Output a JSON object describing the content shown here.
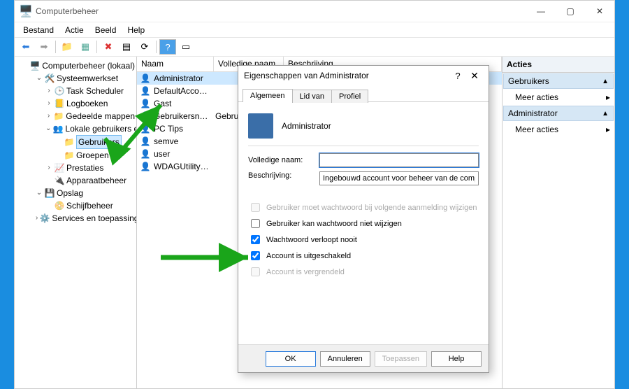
{
  "window": {
    "title": "Computerbeheer",
    "menus": [
      "Bestand",
      "Actie",
      "Beeld",
      "Help"
    ]
  },
  "tree": {
    "root": "Computerbeheer (lokaal)",
    "system": "Systeemwerkset",
    "scheduler": "Task Scheduler",
    "logs": "Logboeken",
    "shared": "Gedeelde mappen",
    "lusers": "Lokale gebruikers en gro…",
    "users": "Gebruikers",
    "groups": "Groepen",
    "perf": "Prestaties",
    "devmgr": "Apparaatbeheer",
    "storage": "Opslag",
    "disk": "Schijfbeheer",
    "services": "Services en toepassingen"
  },
  "list": {
    "col1": "Naam",
    "col2": "Volledige naam",
    "col3": "Beschrijving",
    "rows": [
      {
        "name": "Administrator",
        "full": ""
      },
      {
        "name": "DefaultAcco…",
        "full": ""
      },
      {
        "name": "Gast",
        "full": ""
      },
      {
        "name": "Gebruikersn…",
        "full": "Gebruikersn…"
      },
      {
        "name": "PC Tips",
        "full": ""
      },
      {
        "name": "semve",
        "full": ""
      },
      {
        "name": "user",
        "full": ""
      },
      {
        "name": "WDAGUtility…",
        "full": ""
      }
    ]
  },
  "actions": {
    "header": "Acties",
    "section1": "Gebruikers",
    "more": "Meer acties",
    "section2": "Administrator"
  },
  "dialog": {
    "title": "Eigenschappen van Administrator",
    "tabs": [
      "Algemeen",
      "Lid van",
      "Profiel"
    ],
    "name": "Administrator",
    "full_label": "Volledige naam:",
    "full_value": "",
    "desc_label": "Beschrijving:",
    "desc_value": "Ingebouwd account voor beheer van de computer of het domein",
    "cb_mustchange": "Gebruiker moet wachtwoord bij volgende aanmelding wijzigen",
    "cb_cantchange": "Gebruiker kan wachtwoord niet wijzigen",
    "cb_neverexp": "Wachtwoord verloopt nooit",
    "cb_disabled": "Account is uitgeschakeld",
    "cb_locked": "Account is vergrendeld",
    "btn_ok": "OK",
    "btn_cancel": "Annuleren",
    "btn_apply": "Toepassen",
    "btn_help": "Help"
  }
}
